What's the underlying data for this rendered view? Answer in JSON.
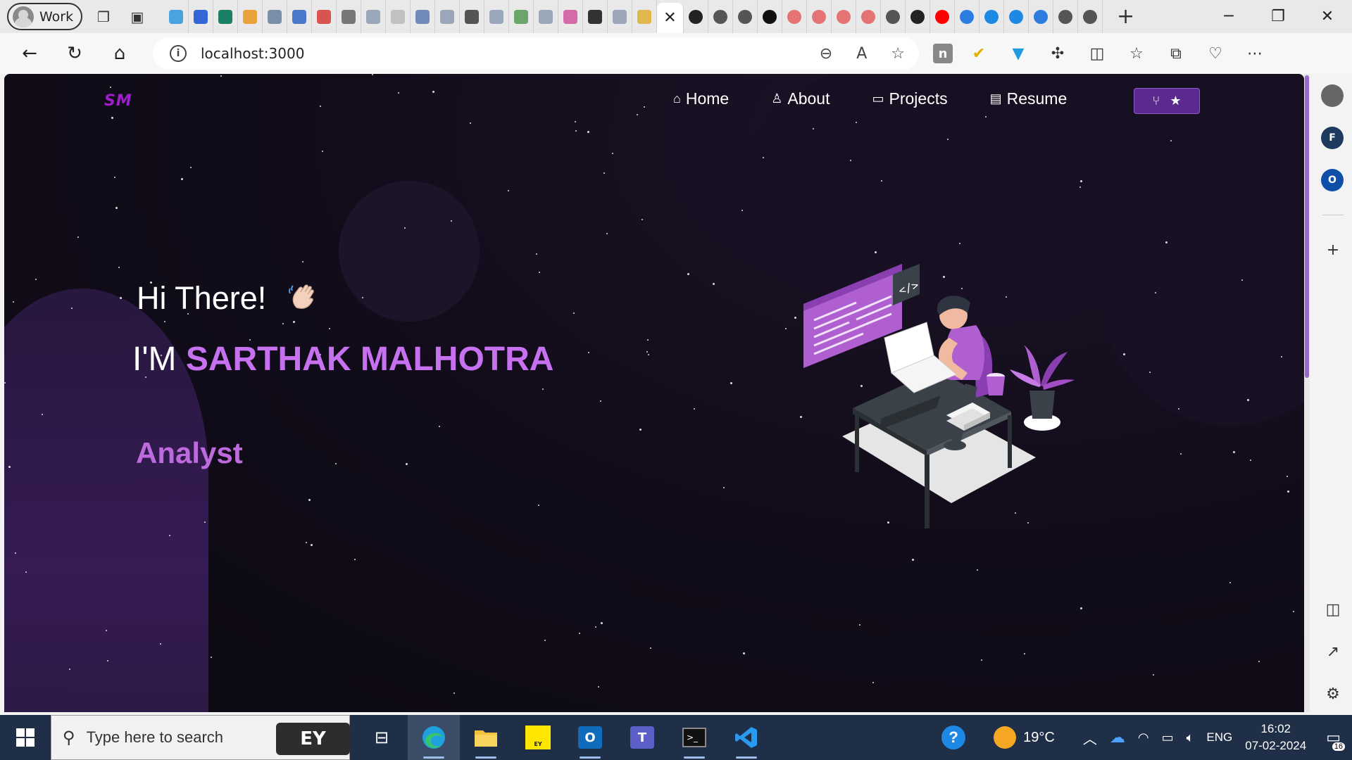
{
  "browser": {
    "profile_label": "Work",
    "url": "localhost:3000",
    "tab_favicons": [
      "#4aa3df",
      "#3367d6",
      "#1a7f64",
      "#e8a33d",
      "#7a8fa8",
      "#4b79c9",
      "#d9534f",
      "#777777",
      "#9aa7b8",
      "#c1c1c1",
      "#6f8ab8",
      "#9aa7b8",
      "#555555",
      "#9aa7b8",
      "#6aa56a",
      "#9aa7b8",
      "#d46aa8",
      "#333333",
      "#9aa7b8",
      "#e0b84d"
    ],
    "pinned_favicons": [
      "#222222",
      "#555555",
      "#555555",
      "#111111",
      "#e57373",
      "#e57373",
      "#e57373",
      "#e57373",
      "#555555",
      "#222222",
      "#ff0000",
      "#2d7de0",
      "#1e88e5",
      "#1e88e5",
      "#2d7de0",
      "#555555",
      "#555555"
    ]
  },
  "site": {
    "logo": "SM",
    "nav": [
      {
        "icon": "⌂",
        "label": "Home"
      },
      {
        "icon": "♙",
        "label": "About"
      },
      {
        "icon": "▭",
        "label": "Projects"
      },
      {
        "icon": "▤",
        "label": "Resume"
      }
    ],
    "fork_icon": "⑂",
    "star_icon": "★",
    "greeting": "Hi There!",
    "im": "I'M ",
    "name": "SARTHAK MALHOTRA",
    "role": "Analyst",
    "colors": {
      "accent": "#c770f0",
      "role": "#be6adf",
      "button": "#5b2a8f",
      "logo": "#9c1fc9"
    }
  },
  "sidebar": {
    "items": [
      {
        "label": "",
        "color": "#666666"
      },
      {
        "label": "F",
        "color": "#1e3a5f"
      },
      {
        "label": "O",
        "color": "#0f4fa8"
      }
    ]
  },
  "taskbar": {
    "search_placeholder": "Type here to search",
    "ey_label": "EY",
    "weather": "19°C",
    "language": "ENG",
    "time": "16:02",
    "date": "07-02-2024",
    "notifications": "16"
  }
}
